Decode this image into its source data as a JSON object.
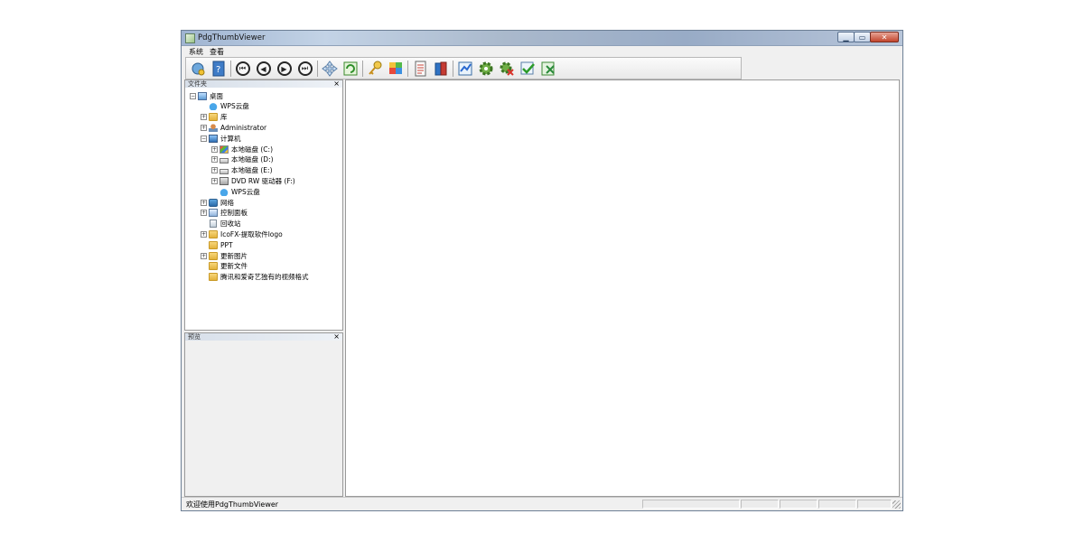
{
  "window": {
    "title": "PdgThumbViewer"
  },
  "menu": [
    {
      "label": "系统"
    },
    {
      "label": "查看"
    }
  ],
  "toolbar": {
    "buttons": [
      {
        "icon": "find-icon"
      },
      {
        "icon": "help-book-icon"
      },
      {
        "icon": "first-page-icon",
        "glyph": "⏮"
      },
      {
        "icon": "previous-page-icon",
        "glyph": "◀"
      },
      {
        "icon": "next-page-icon",
        "glyph": "▶"
      },
      {
        "icon": "last-page-icon",
        "glyph": "⏭"
      },
      {
        "icon": "move-icon"
      },
      {
        "icon": "refresh-icon"
      },
      {
        "icon": "key-icon"
      },
      {
        "icon": "puzzle-icon"
      },
      {
        "icon": "document-icon"
      },
      {
        "icon": "books-icon"
      },
      {
        "icon": "chart-icon"
      },
      {
        "icon": "settings-icon"
      },
      {
        "icon": "remove-settings-icon"
      },
      {
        "icon": "check-icon"
      },
      {
        "icon": "exit-icon"
      }
    ]
  },
  "folder_panel": {
    "title": "文件夹",
    "close": "×",
    "tree": [
      {
        "label": "桌面",
        "toggle": "−",
        "icon": "desktop"
      },
      {
        "label": "WPS云盘",
        "toggle": "",
        "icon": "cloud"
      },
      {
        "label": "库",
        "toggle": "+",
        "icon": "folder"
      },
      {
        "label": "Administrator",
        "toggle": "+",
        "icon": "user"
      },
      {
        "label": "计算机",
        "toggle": "−",
        "icon": "computer"
      },
      {
        "label": "本地磁盘 (C:)",
        "toggle": "+",
        "icon": "win"
      },
      {
        "label": "本地磁盘 (D:)",
        "toggle": "+",
        "icon": "drive"
      },
      {
        "label": "本地磁盘 (E:)",
        "toggle": "+",
        "icon": "drive"
      },
      {
        "label": "DVD RW 驱动器 (F:)",
        "toggle": "+",
        "icon": "dvd"
      },
      {
        "label": "WPS云盘",
        "toggle": "",
        "icon": "cloud"
      },
      {
        "label": "网络",
        "toggle": "+",
        "icon": "net"
      },
      {
        "label": "控制面板",
        "toggle": "+",
        "icon": "panel"
      },
      {
        "label": "回收站",
        "toggle": "",
        "icon": "bin"
      },
      {
        "label": "IcoFX-提取软件logo",
        "toggle": "+",
        "icon": "folder"
      },
      {
        "label": "PPT",
        "toggle": "",
        "icon": "folder"
      },
      {
        "label": "更新图片",
        "toggle": "+",
        "icon": "folder"
      },
      {
        "label": "更新文件",
        "toggle": "",
        "icon": "folder"
      },
      {
        "label": "腾讯和爱奇艺独有的视频格式",
        "toggle": "",
        "icon": "folder"
      }
    ]
  },
  "preview_panel": {
    "title": "预览",
    "close": "×"
  },
  "status": {
    "text": "欢迎使用PdgThumbViewer"
  }
}
